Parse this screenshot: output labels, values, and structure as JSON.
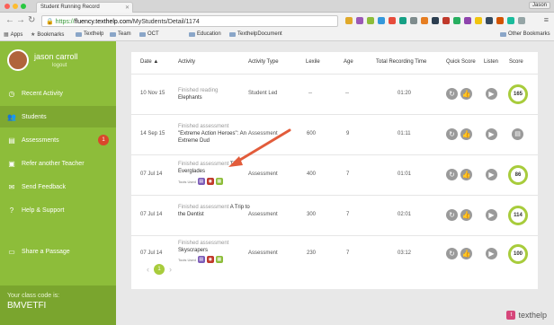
{
  "browser": {
    "tab_title": "Student Running Record",
    "user_chip": "Jason",
    "url_https": "https://",
    "url_host": "fluency.texthelp.com",
    "url_path": "/MyStudents/Detail/1174"
  },
  "bookmarks": {
    "items": [
      {
        "label": "Apps",
        "icon": "apps-grid-icon"
      },
      {
        "label": "Bookmarks",
        "icon": "star-icon"
      },
      {
        "label": "Texthelp",
        "icon": "folder-icon"
      },
      {
        "label": "Team",
        "icon": "folder-icon"
      },
      {
        "label": "OCT",
        "icon": "folder-icon"
      },
      {
        "label": "Education",
        "icon": "folder-icon"
      },
      {
        "label": "TexthelpDocument",
        "icon": "folder-icon"
      }
    ],
    "other": "Other Bookmarks"
  },
  "profile": {
    "name": "jason carroll",
    "logout": "logout"
  },
  "sidebar": {
    "items": [
      {
        "label": "Recent Activity",
        "icon": "clock-icon"
      },
      {
        "label": "Students",
        "icon": "students-icon"
      },
      {
        "label": "Assessments",
        "icon": "document-icon",
        "badge": "1"
      },
      {
        "label": "Refer another Teacher",
        "icon": "refer-icon"
      },
      {
        "label": "Send Feedback",
        "icon": "envelope-icon"
      },
      {
        "label": "Help & Support",
        "icon": "question-icon"
      },
      {
        "label": "Share a Passage",
        "icon": "share-icon"
      }
    ],
    "class_code_label": "Your class code is:",
    "class_code": "BMVETFI"
  },
  "table": {
    "headers": {
      "date": "Date ▲",
      "activity": "Activity",
      "type": "Activity Type",
      "lexile": "Lexile",
      "age": "Age",
      "time": "Total Recording Time",
      "quick": "Quick Score",
      "listen": "Listen",
      "score": "Score"
    },
    "rows": [
      {
        "date": "10 Nov 15",
        "status": "Finished reading",
        "title": "Elephants",
        "type": "Student Led",
        "lexile": "--",
        "age": "--",
        "time": "01:20",
        "score": "165",
        "tools": false
      },
      {
        "date": "14 Sep 15",
        "status": "Finished assessment",
        "title": "\"Extreme Action Heroes\": An Extreme Dud",
        "type": "Assessment",
        "lexile": "600",
        "age": "9",
        "time": "01:11",
        "score": "",
        "tools": false
      },
      {
        "date": "07 Jul 14",
        "status": "Finished assessment",
        "title": "The Everglades",
        "type": "Assessment",
        "lexile": "400",
        "age": "7",
        "time": "01:01",
        "score": "86",
        "tools": true,
        "tools_label": "Tools Used"
      },
      {
        "date": "07 Jul 14",
        "status": "Finished assessment",
        "title": "A Trip to the Dentist",
        "type": "Assessment",
        "lexile": "300",
        "age": "7",
        "time": "02:01",
        "score": "114",
        "tools": false
      },
      {
        "date": "07 Jul 14",
        "status": "Finished assessment",
        "title": "Skyscrapers",
        "type": "Assessment",
        "lexile": "230",
        "age": "7",
        "time": "03:12",
        "score": "100",
        "tools": true,
        "tools_label": "Tools Used"
      }
    ]
  },
  "pager": {
    "current": "1"
  },
  "brand": {
    "logo": "texthelp"
  },
  "colors": {
    "sidebar": "#8dbd3a",
    "score_ring": "#a8cc3c",
    "badge": "#d9472b",
    "arrow": "#e25c3b"
  }
}
